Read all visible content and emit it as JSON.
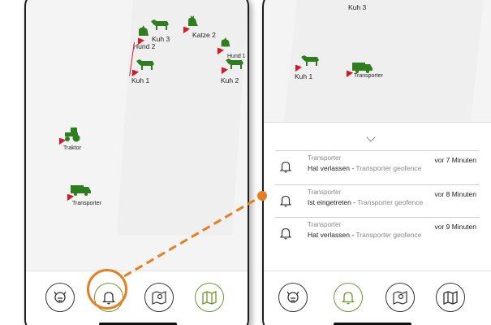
{
  "left_map": {
    "animals": [
      {
        "label": "Kuh 3"
      },
      {
        "label": "Hund 2"
      },
      {
        "label": "Katze 2"
      },
      {
        "label": "Hund 1"
      },
      {
        "label": "Kuh 1"
      },
      {
        "label": "Kuh 2"
      },
      {
        "label": "Traktor"
      },
      {
        "label": "Transporter"
      }
    ]
  },
  "right_map": {
    "labels": [
      {
        "label": "Kuh 3"
      },
      {
        "label": "Kuh 1"
      },
      {
        "label": "Transporter"
      }
    ]
  },
  "notifications": [
    {
      "source": "Transporter",
      "time": "vor 7 Minuten",
      "event": "Hat verlassen -",
      "geofence": "Transporter geofence"
    },
    {
      "source": "Transporter",
      "time": "vor 8 Minuten",
      "event": "Ist eingetreten -",
      "geofence": "Transporter geofence"
    },
    {
      "source": "Transporter",
      "time": "vor 9 Minuten",
      "event": "Hat verlassen -",
      "geofence": "Transporter geofence"
    }
  ],
  "nav": {
    "items": [
      "animals-icon",
      "bell-icon",
      "map-pin-icon",
      "map-icon"
    ]
  },
  "colors": {
    "accent": "#6a9a2c",
    "animal": "#2e7d1e",
    "pin": "#d11a2a",
    "highlight": "#e67e22"
  }
}
